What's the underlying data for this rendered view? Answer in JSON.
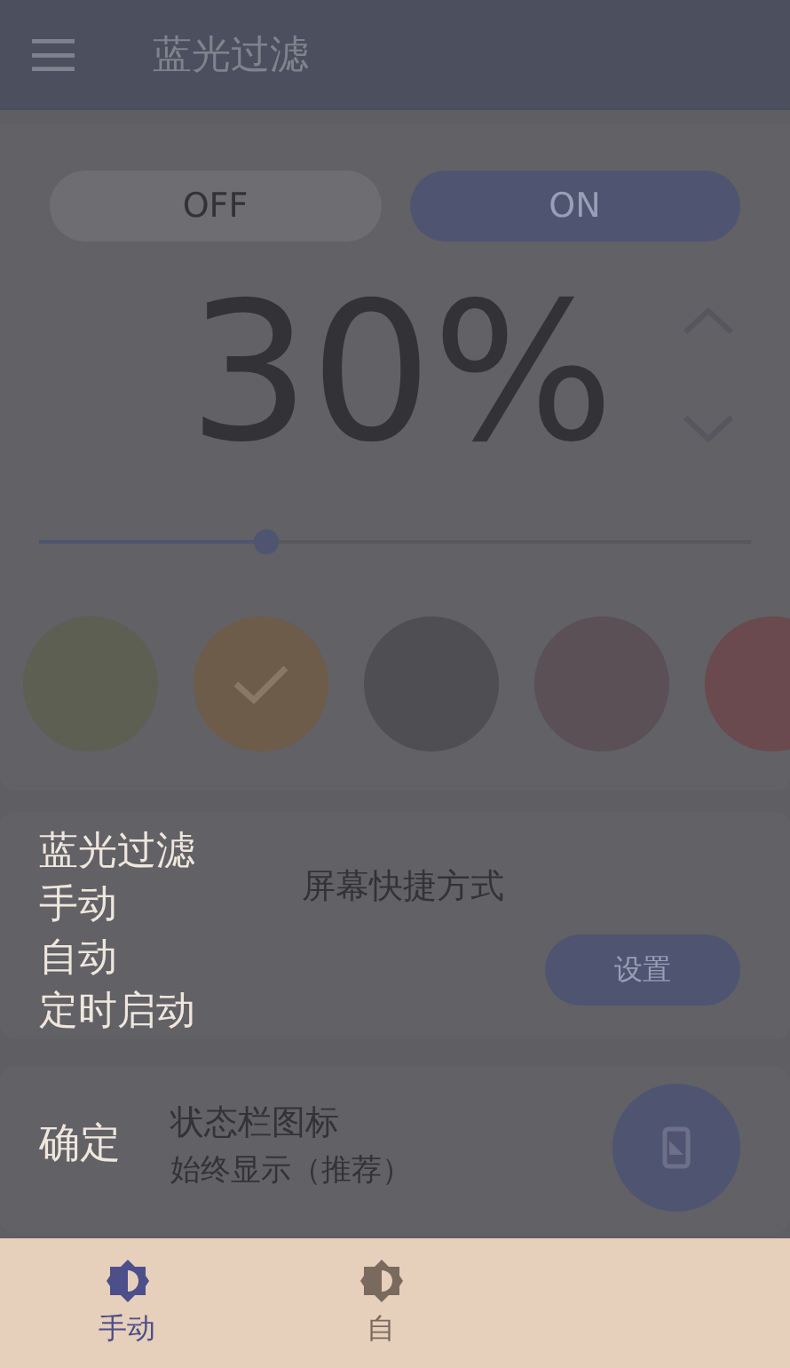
{
  "app_bar": {
    "title": "蓝光过滤"
  },
  "power": [
    {
      "label": "OFF",
      "selected": false
    },
    {
      "label": "ON",
      "selected": true
    }
  ],
  "intensity": {
    "reading": "30%",
    "level": 0.32
  },
  "swatches": [
    {
      "color": "#5d5f52",
      "selected": false
    },
    {
      "color": "#6e5c4a",
      "selected": true
    },
    {
      "color": "#4e4e53",
      "selected": false
    },
    {
      "color": "#5a5055",
      "selected": false
    },
    {
      "color": "#6a4a4e",
      "selected": false
    }
  ],
  "shortcut_card": {
    "title": "屏幕快捷方式",
    "button": "设置"
  },
  "status_card": {
    "title": "状态栏图标",
    "subtitle": "始终显示（推荐）"
  },
  "tutorial_menu": {
    "items": [
      "蓝光过滤",
      "手动",
      "自动",
      "定时启动"
    ],
    "confirm": "确定"
  },
  "bottom_nav": [
    {
      "label": "手动",
      "selected": true
    },
    {
      "label": "自",
      "selected": false
    }
  ]
}
